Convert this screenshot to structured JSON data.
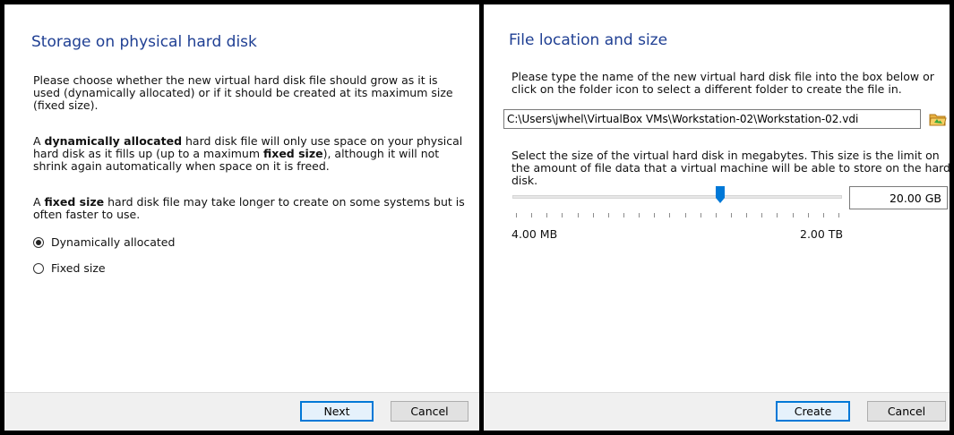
{
  "left_dialog": {
    "title": "Storage on physical hard disk",
    "para1": "Please choose whether the new virtual hard disk file should grow as it is used (dynamically allocated) or if it should be created at its maximum size (fixed size).",
    "para2_a": "A ",
    "para2_b1": "dynamically allocated",
    "para2_c": " hard disk file will only use space on your physical hard disk as it fills up (up to a maximum ",
    "para2_b2": "fixed size",
    "para2_d": "), although it will not shrink again automatically when space on it is freed.",
    "para3_a": "A ",
    "para3_b": "fixed size",
    "para3_c": " hard disk file may take longer to create on some systems but is often faster to use.",
    "options": [
      {
        "label": "Dynamically allocated",
        "checked": true
      },
      {
        "label": "Fixed size",
        "checked": false
      }
    ],
    "next_label": "Next",
    "cancel_label": "Cancel"
  },
  "right_dialog": {
    "title": "File location and size",
    "para1": "Please type the name of the new virtual hard disk file into the box below or click on the folder icon to select a different folder to create the file in.",
    "file_path": "C:\\Users\\jwhel\\VirtualBox VMs\\Workstation-02\\Workstation-02.vdi",
    "folder_icon": "folder-icon",
    "para2": "Select the size of the virtual hard disk in megabytes. This size is the limit on the amount of file data that a virtual machine will be able to store on the hard disk.",
    "slider_fraction": 0.63,
    "size_value": "20.00 GB",
    "min_label": "4.00 MB",
    "max_label": "2.00 TB",
    "create_label": "Create",
    "cancel_label": "Cancel"
  },
  "colors": {
    "title": "#1f3f93",
    "accent": "#0078d7",
    "footer": "#f0f0f0"
  }
}
